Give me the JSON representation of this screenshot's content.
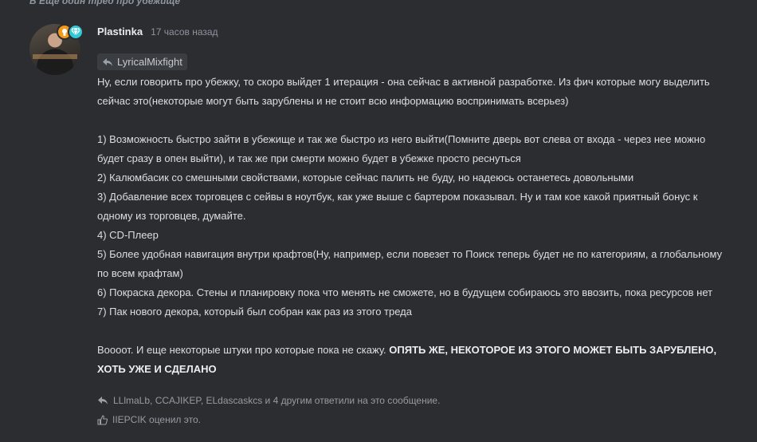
{
  "thread": {
    "header": "В Еще один тред про убежище"
  },
  "post": {
    "username": "Plastinka",
    "timestamp": "17 часов назад",
    "reply_to": "LyricalMixfight",
    "paragraphs": [
      "Ну, если говорить про убежку, то скоро выйдет 1 итерация - она сейчас в активной разработке. Из фич которые могу выделить сейчас это(некоторые могут быть зарублены и не стоит всю информацию воспринимать всерьез)"
    ],
    "items": [
      "1) Возможность быстро зайти в убежище и так же быстро из него выйти(Помните дверь вот слева от входа - через нее можно будет сразу в опен выйти), и так же при смерти можно будет в убежке просто реснуться",
      "2) Калюмбасик со смешными свойствами, которые сейчас палить не буду, но надеюсь останетесь довольными",
      "3) Добавление всех торговцев с сейвы в ноутбук, как уже выше с бартером показывал. Ну и там кое какой приятный бонус к одному из торговцев, думайте.",
      "4) CD-Плеер",
      "5) Более удобная навигация внутри крафтов(Ну, например, если повезет то Поиск теперь будет не по категориям, а глобальному по всем крафтам)",
      "6) Покраска декора. Стены и планировку пока что менять не сможете, но в будущем собираюсь это ввозить, пока ресурсов нет",
      "7) Пак нового декора, который был собран как раз из этого треда"
    ],
    "closing_plain": "Воооот. И еще некоторые штуки про которые пока не скажу.",
    "closing_bold": "ОПЯТЬ ЖЕ, НЕКОТОРОЕ ИЗ ЭТОГО МОЖЕТ БЫТЬ ЗАРУБЛЕНО, ХОТЬ УЖЕ И СДЕЛАНО"
  },
  "footer": {
    "replies_text": "LLlmaLb, CCAJIKEP, ELdascaskcs и 4 другим ответили на это сообщение.",
    "likes_text": "IIEPCIK оценил это."
  },
  "icons": {
    "reply": "reply-arrow-icon",
    "like": "thumbs-up-icon",
    "badge_a": "award-badge-icon",
    "badge_b": "diamond-badge-icon"
  },
  "colors": {
    "background": "#2b2d31",
    "badge_orange": "#f29a1c",
    "badge_cyan": "#2fc9d6"
  }
}
